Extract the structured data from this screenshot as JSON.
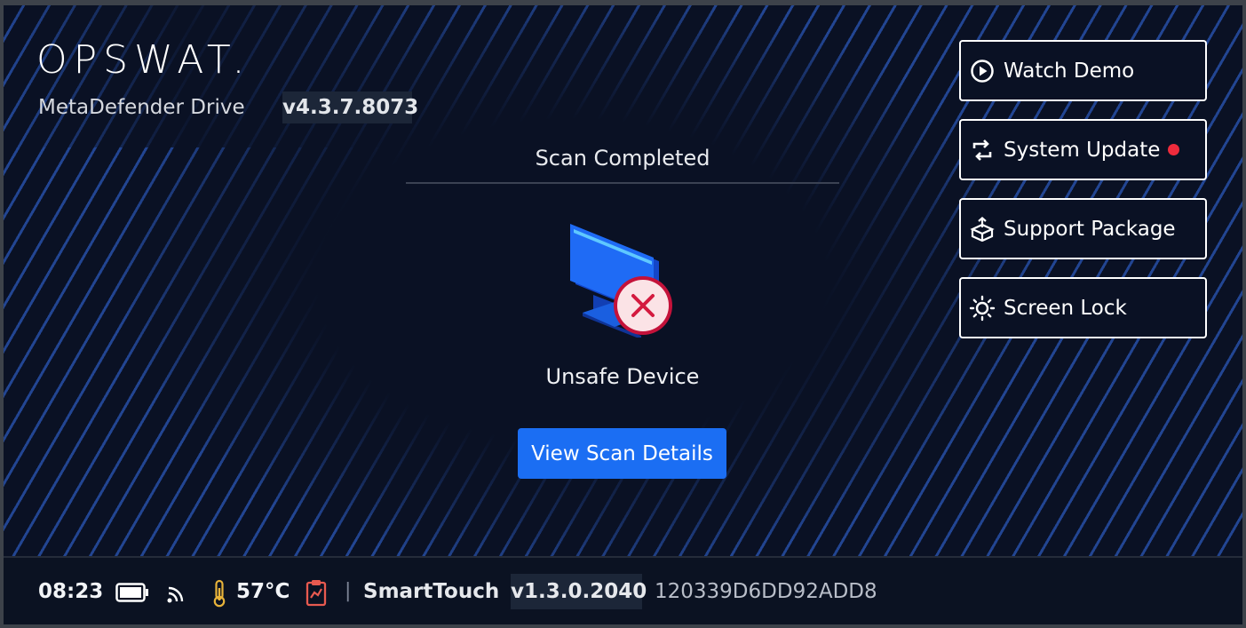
{
  "header": {
    "logo_text": "OPSWAT.",
    "product_name": "MetaDefender Drive",
    "version": "v4.3.7.8073"
  },
  "scan": {
    "title": "Scan Completed",
    "device_icon": "monitor-with-x-icon",
    "status": "Unsafe Device",
    "details_button": "View Scan Details"
  },
  "side_menu": {
    "items": [
      {
        "label": "Watch Demo",
        "icon": "play-circle-icon",
        "badge": false
      },
      {
        "label": "System Update",
        "icon": "refresh-icon",
        "badge": true
      },
      {
        "label": "Support Package",
        "icon": "package-upload-icon",
        "badge": false
      },
      {
        "label": "Screen Lock",
        "icon": "sun-icon",
        "badge": false
      }
    ]
  },
  "status_bar": {
    "time": "08:23",
    "battery_icon": "battery-icon",
    "wifi_icon": "signal-icon",
    "temperature": "57°C",
    "thermometer_icon": "thermometer-icon",
    "clipboard_icon": "clipboard-chart-icon",
    "separator": "|",
    "device_name": "SmartTouch",
    "firmware_version": "v1.3.0.2040",
    "serial": "120339D6DD92ADD8"
  },
  "colors": {
    "background": "#0a1124",
    "stripe": "#264ea5",
    "primary_button": "#1b6ef3",
    "badge_red": "#ef2b3c",
    "thermometer": "#e8b33a",
    "clipboard": "#e85a50"
  }
}
